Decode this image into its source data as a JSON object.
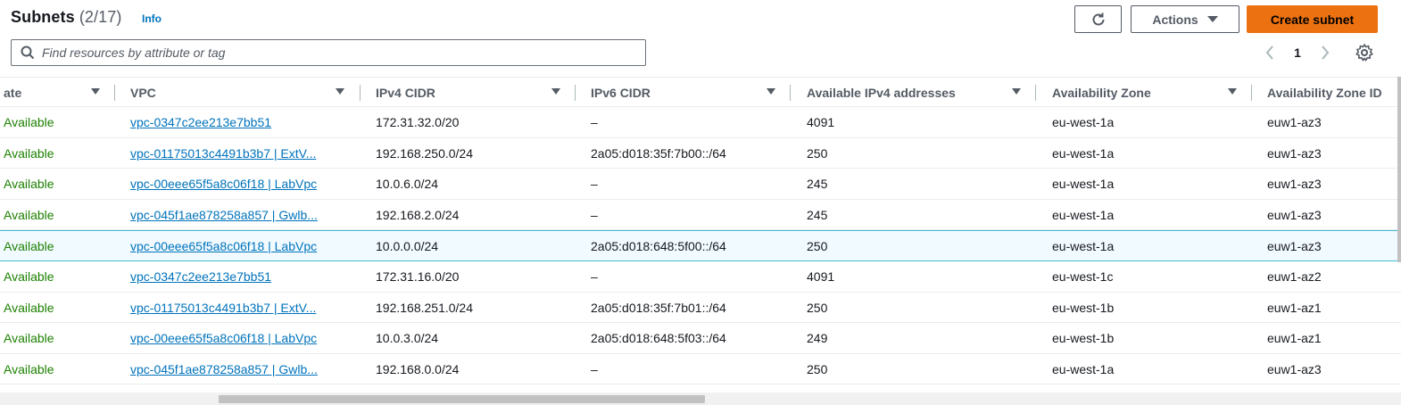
{
  "header": {
    "title": "Subnets",
    "count": "(2/17)",
    "info_label": "Info",
    "actions_label": "Actions",
    "create_label": "Create subnet"
  },
  "search": {
    "placeholder": "Find resources by attribute or tag",
    "value": ""
  },
  "pagination": {
    "current_page": "1"
  },
  "table": {
    "columns": [
      {
        "label": "ate"
      },
      {
        "label": "VPC"
      },
      {
        "label": "IPv4 CIDR"
      },
      {
        "label": "IPv6 CIDR"
      },
      {
        "label": "Available IPv4 addresses"
      },
      {
        "label": "Availability Zone"
      },
      {
        "label": "Availability Zone ID"
      }
    ],
    "rows": [
      {
        "state": "Available",
        "vpc": "vpc-0347c2ee213e7bb51",
        "ipv4": "172.31.32.0/20",
        "ipv6": "–",
        "available": "4091",
        "az": "eu-west-1a",
        "azid": "euw1-az3"
      },
      {
        "state": "Available",
        "vpc": "vpc-01175013c4491b3b7 | ExtV...",
        "ipv4": "192.168.250.0/24",
        "ipv6": "2a05:d018:35f:7b00::/64",
        "available": "250",
        "az": "eu-west-1a",
        "azid": "euw1-az3"
      },
      {
        "state": "Available",
        "vpc": "vpc-00eee65f5a8c06f18 | LabVpc",
        "ipv4": "10.0.6.0/24",
        "ipv6": "–",
        "available": "245",
        "az": "eu-west-1a",
        "azid": "euw1-az3"
      },
      {
        "state": "Available",
        "vpc": "vpc-045f1ae878258a857 | Gwlb...",
        "ipv4": "192.168.2.0/24",
        "ipv6": "–",
        "available": "245",
        "az": "eu-west-1a",
        "azid": "euw1-az3"
      },
      {
        "state": "Available",
        "vpc": "vpc-00eee65f5a8c06f18 | LabVpc",
        "ipv4": "10.0.0.0/24",
        "ipv6": "2a05:d018:648:5f00::/64",
        "available": "250",
        "az": "eu-west-1a",
        "azid": "euw1-az3"
      },
      {
        "state": "Available",
        "vpc": "vpc-0347c2ee213e7bb51",
        "ipv4": "172.31.16.0/20",
        "ipv6": "–",
        "available": "4091",
        "az": "eu-west-1c",
        "azid": "euw1-az2"
      },
      {
        "state": "Available",
        "vpc": "vpc-01175013c4491b3b7 | ExtV...",
        "ipv4": "192.168.251.0/24",
        "ipv6": "2a05:d018:35f:7b01::/64",
        "available": "250",
        "az": "eu-west-1b",
        "azid": "euw1-az1"
      },
      {
        "state": "Available",
        "vpc": "vpc-00eee65f5a8c06f18 | LabVpc",
        "ipv4": "10.0.3.0/24",
        "ipv6": "2a05:d018:648:5f03::/64",
        "available": "249",
        "az": "eu-west-1b",
        "azid": "euw1-az1"
      },
      {
        "state": "Available",
        "vpc": "vpc-045f1ae878258a857 | Gwlb...",
        "ipv4": "192.168.0.0/24",
        "ipv6": "–",
        "available": "250",
        "az": "eu-west-1a",
        "azid": "euw1-az3"
      }
    ]
  },
  "colors": {
    "accent": "#ec7211",
    "link": "#0073bb",
    "available": "#1d8102",
    "selected_row": "#f1faff"
  }
}
